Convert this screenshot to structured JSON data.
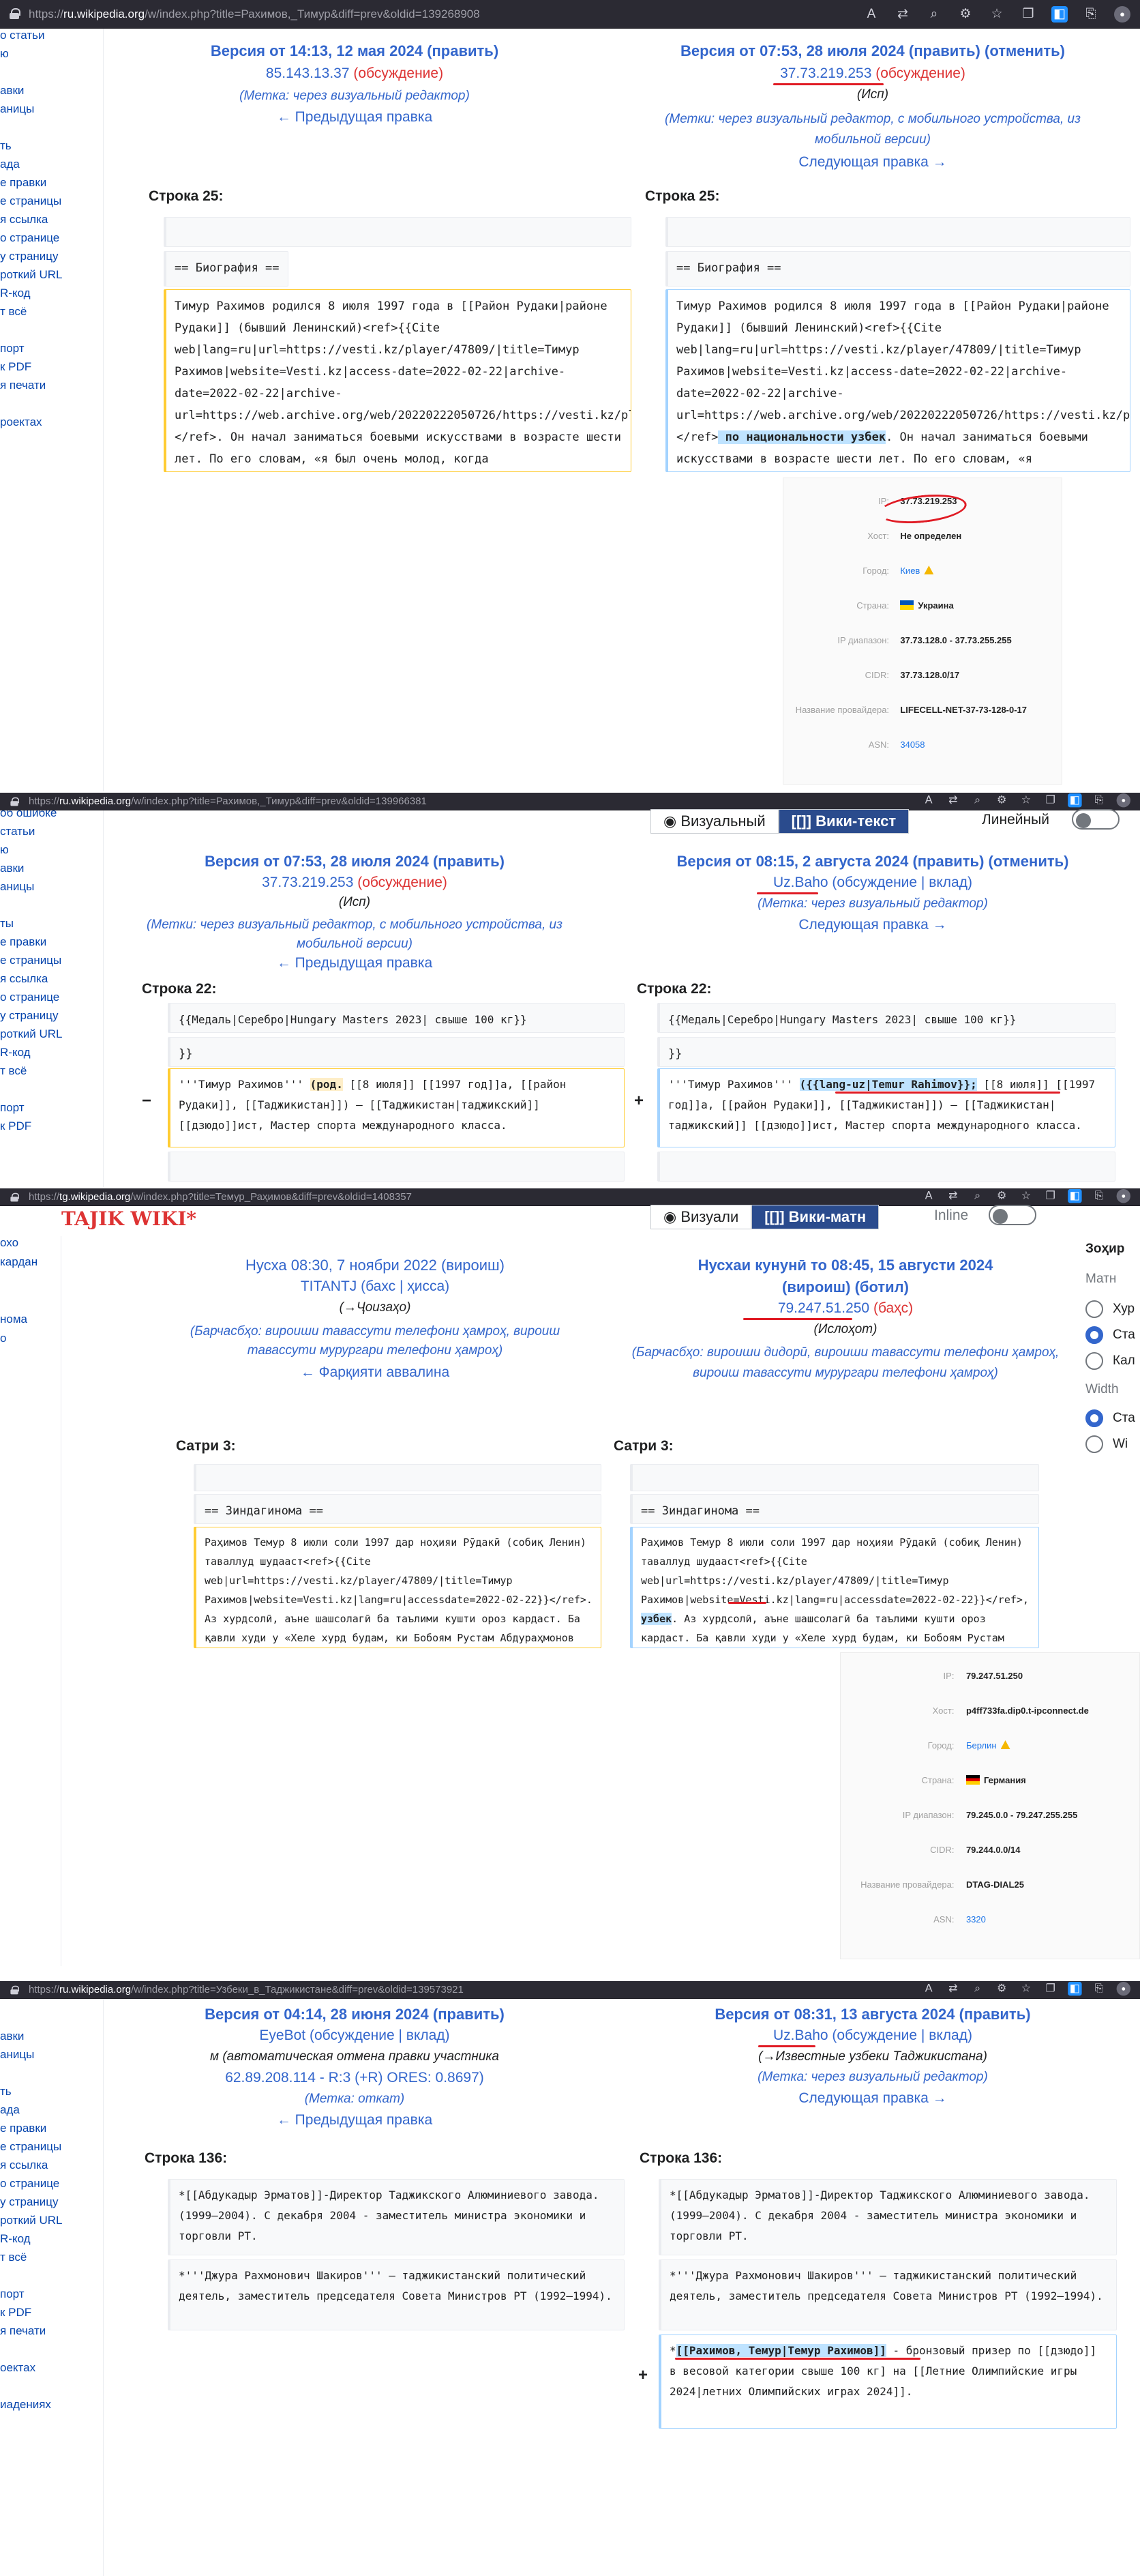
{
  "p1": {
    "url_pre": "https://",
    "url_host": "ru.wikipedia.org",
    "url_path": "/w/index.php?title=Рахимов,_Тимур&diff=prev&oldid=139268908",
    "sidebar": [
      "о статьи",
      "ю",
      "",
      "авки",
      "аницы",
      "",
      "ть",
      "ада",
      "е правки",
      "е страницы",
      "я ссылка",
      "о странице",
      "у страницу",
      "роткий URL",
      "R-код",
      "т всё",
      "",
      "порт",
      "к PDF",
      "я печати",
      "",
      "роектах"
    ],
    "left": {
      "title": "Версия от 14:13, 12 мая 2024",
      "edit": "(править)",
      "user": "85.143.13.37",
      "talk": "(обсуждение)",
      "tags": "(Метка: через визуальный редактор)",
      "nav": "← Предыдущая правка"
    },
    "right": {
      "title": "Версия от 07:53, 28 июля 2024",
      "edit": "(править)",
      "undo": "(отменить)",
      "user": "37.73.219.253",
      "talk": "(обсуждение)",
      "summary": "(Исп)",
      "tags": "(Метки: через визуальный редактор, с мобильного устройства, из мобильной версии)",
      "nav": "Следующая правка →"
    },
    "row_label": "Строка 25:",
    "ctx2": "== Биография ==",
    "del_text": "Тимур Рахимов родился 8 июля 1997 года в [[Район Рудаки|районе Рудаки]] (бывший Ленинский)<ref>{{Cite web|lang=ru|url=https://vesti.kz/player/47809/|title=Тимур Рахимов|website=Vesti.kz|access-date=2022-02-22|archive-date=2022-02-22|archive-url=https://web.archive.org/web/20220222050726/https://vesti.kz/player/47809/|deadlink=no}}</ref>. Он начал заниматься боевыми искусствами в возрасте шести лет. По его словам, «я был очень молод, когда",
    "add_pre": "Тимур Рахимов родился 8 июля 1997 года в [[Район Рудаки|районе Рудаки]] (бывший Ленинский)<ref>{{Cite web|lang=ru|url=https://vesti.kz/player/47809/|title=Тимур Рахимов|website=Vesti.kz|access-date=2022-02-22|archive-date=2022-02-22|archive-url=https://web.archive.org/web/20220222050726/https://vesti.kz/player/47809/|deadlink=no}}</ref>",
    "add_hl": " по национальности узбек",
    "add_post": ". Он начал заниматься боевыми искусствами в возрасте шести лет. По его словам, «я",
    "ip": {
      "rows": [
        [
          "IP:",
          "37.73.219.253"
        ],
        [
          "Хост:",
          "Не определен"
        ],
        [
          "Город:",
          "Киев"
        ],
        [
          "Страна:",
          "Украина"
        ],
        [
          "IP диапазон:",
          "37.73.128.0 - 37.73.255.255"
        ],
        [
          "CIDR:",
          "37.73.128.0/17"
        ],
        [
          "Название провайдера:",
          "LIFECELL-NET-37-73-128-0-17"
        ],
        [
          "ASN:",
          "34058"
        ]
      ]
    }
  },
  "p2": {
    "url_pre": "https://",
    "url_host": "ru.wikipedia.org",
    "url_path": "/w/index.php?title=Рахимов,_Тимур&diff=prev&oldid=139966381",
    "sidebar": [
      "об ошибке",
      "статьи",
      "ю",
      "авки",
      "аницы",
      "",
      "ты",
      "е правки",
      "е страницы",
      "я ссылка",
      "о странице",
      "у страницу",
      "роткий URL",
      "R-код",
      "т всё",
      "",
      "порт",
      "к PDF"
    ],
    "toggle_visual": "Визуальный",
    "toggle_wiki": "Вики-текст",
    "toggle_inline": "Линейный",
    "left": {
      "title": "Версия от 07:53, 28 июля 2024",
      "edit": "(править)",
      "user": "37.73.219.253",
      "talk": "(обсуждение)",
      "summary": "(Исп)",
      "tags": "(Метки: через визуальный редактор, с мобильного устройства, из мобильной версии)",
      "nav": "← Предыдущая правка"
    },
    "right": {
      "title": "Версия от 08:15, 2 августа 2024",
      "edit": "(править)",
      "undo": "(отменить)",
      "user": "Uz.Baho",
      "talk": "(обсуждение | вклад)",
      "tags": "(Метка: через визуальный редактор)",
      "nav": "Следующая правка →"
    },
    "row_label": "Строка 22:",
    "ctx1": "{{Медаль|Серебро|Hungary Masters 2023| свыше 100 кг}}",
    "ctx2": "}}",
    "del_pre": "'''Тимур Рахимов''' ",
    "del_hl": "(род.",
    "del_post": " [[8 июля]] [[1997 год]]а, [[район Рудаки]], [[Таджикистан]]) — [[Таджикистан|таджикский]] [[дзюдо]]ист, Мастер спорта международного класса.",
    "add_pre": "'''Тимур Рахимов''' ",
    "add_hl": "({{lang-uz|Temur Rahimov}};",
    "add_post": " [[8 июля]] [[1997 год]]а, [[район Рудаки]], [[Таджикистан]]) — [[Таджикистан|таджикский]] [[дзюдо]]ист, Мастер спорта международного класса."
  },
  "p3": {
    "url_pre": "https://",
    "url_host": "tg.wikipedia.org",
    "url_path": "/w/index.php?title=Темур_Раҳимов&diff=prev&oldid=1408357",
    "logo": "TAJIK WIKI*",
    "sidebar": [
      "охо",
      "кардан",
      "",
      "",
      "номa",
      "о",
      "",
      "",
      "",
      "",
      "",
      "",
      "",
      ""
    ],
    "toggle_visual": "Визуали",
    "toggle_wiki": "Вики-матн",
    "toggle_inline": "Inline",
    "right_panel": {
      "heading": "Зоҳир",
      "m1": "Матн",
      "r1": "Хур",
      "r2": "Ста",
      "r3": "Кал",
      "m2": "Width",
      "r4": "Ста",
      "r5": "Wi"
    },
    "left": {
      "title": "Нусха 08:30, 7 ноябри 2022",
      "edit": "(вироиш)",
      "user": "TITANTJ",
      "talk": "(бахс | ҳисса)",
      "summary": "(→Ҷоизаҳо)",
      "tags": "(Барчасбҳо: вироиши тавассути телефони ҳамроҳ, вироиш тавассути мурургари телефони ҳамроҳ)",
      "nav": "← Фарқияти аввалина"
    },
    "right": {
      "title": "Нусхаи кунунӣ то 08:45, 15 августи 2024",
      "edit": "(вироиш)",
      "undo": "(ботил)",
      "user": "79.247.51.250",
      "talk": "(баҳс)",
      "summary": "(Ислоҳот)",
      "tags": "(Барчасбҳо: вироиши дидорӣ, вироиши тавассути телефони ҳамроҳ, вироиш тавассути мурургари телефони ҳамроҳ)"
    },
    "row_label": "Сатри 3:",
    "ctx2": "== Зиндагинома ==",
    "del_text": "Раҳимов Темур 8 июли соли 1997 дар ноҳияи Рӯдакӣ (собиқ Ленин) таваллуд шудааст<ref>{{Cite web|url=https://vesti.kz/player/47809/|title=Тимур Рахимов|website=Vesti.kz|lang=ru|accessdate=2022-02-22}}</ref>. Аз хурдсолӣ, аъне шашсолагӣ ба таълими кушти ороз кардаст. Ба қавли худи у «Хеле хурд будам, ки Бобоям Рустам Абдураҳмонов маро барои",
    "add_pre": "Раҳимов Темур 8 июли соли 1997 дар ноҳияи Рӯдакӣ (собиқ Ленин) таваллуд шудааст<ref>{{Cite web|url=https://vesti.kz/player/47809/|title=Тимур Рахимов|website=Vesti.kz|lang=ru|accessdate=2022-02-22}}</ref>, ",
    "add_hl": "узбек",
    "add_post": ". Аз хурдсолӣ, аъне шашсолагӣ ба таълими кушти ороз кардаст. Ба қавли худи у «Хеле хурд будам, ки Бобоям Рустам Абдураҳмонов маро",
    "ip": {
      "rows": [
        [
          "IP:",
          "79.247.51.250"
        ],
        [
          "Хост:",
          "p4ff733fa.dip0.t-ipconnect.de"
        ],
        [
          "Город:",
          "Берлин"
        ],
        [
          "Страна:",
          "Германия"
        ],
        [
          "IP диапазон:",
          "79.245.0.0 - 79.247.255.255"
        ],
        [
          "CIDR:",
          "79.244.0.0/14"
        ],
        [
          "Название провайдера:",
          "DTAG-DIAL25"
        ],
        [
          "ASN:",
          "3320"
        ]
      ]
    }
  },
  "p4": {
    "url_pre": "https://",
    "url_host": "ru.wikipedia.org",
    "url_path": "/w/index.php?title=Узбеки_в_Таджикистане&diff=prev&oldid=139573921",
    "sidebar": [
      "",
      "авки",
      "аницы",
      "",
      "ть",
      "ада",
      "е правки",
      "е страницы",
      "я ссылка",
      "о странице",
      "у страницу",
      "роткий URL",
      "R-код",
      "т всё",
      "",
      "порт",
      "к PDF",
      "я печати",
      "",
      "оектах",
      "",
      "иадениях"
    ],
    "left": {
      "title": "Версия от 04:14, 28 июня 2024",
      "edit": "(править)",
      "user": "EyeBot",
      "talk": "(обсуждение | вклад)",
      "summary": "м (автоматическая отмена правки участника",
      "summary2": "62.89.208.114 - R:3 (+R) ORES: 0.8697)",
      "tags": "(Метка: откат)",
      "nav": "← Предыдущая правка"
    },
    "right": {
      "title": "Версия от 08:31, 13 августа 2024",
      "edit": "(править)",
      "user": "Uz.Baho",
      "talk": "(обсуждение | вклад)",
      "summary": "(→Известные узбеки Таджикистана)",
      "tags": "(Метка: через визуальный редактор)",
      "nav": "Следующая правка →"
    },
    "row_label": "Строка 136:",
    "ctx1": "*[[Абдукадыр Эрматов]]-Директор Таджикского Алюминиевого завода. (1999—2004). С декабря 2004 - заместитель министра экономики и торговли РТ.",
    "ctx2": "*'''Джура Рахмонович Шакиров''' — таджикистанский политический деятель, заместитель председателя Совета Министров РТ (1992—1994).",
    "add_pre": "*",
    "add_hl": "[[Рахимов, Темур|Темур Рахимов]]",
    "add_post": " - бронзовый призер по [[дзюдо]] в весовой категории свыше 100 кг] на [[Летние Олимпийские игры 2024|летних Олимпийских играх 2024]]."
  }
}
